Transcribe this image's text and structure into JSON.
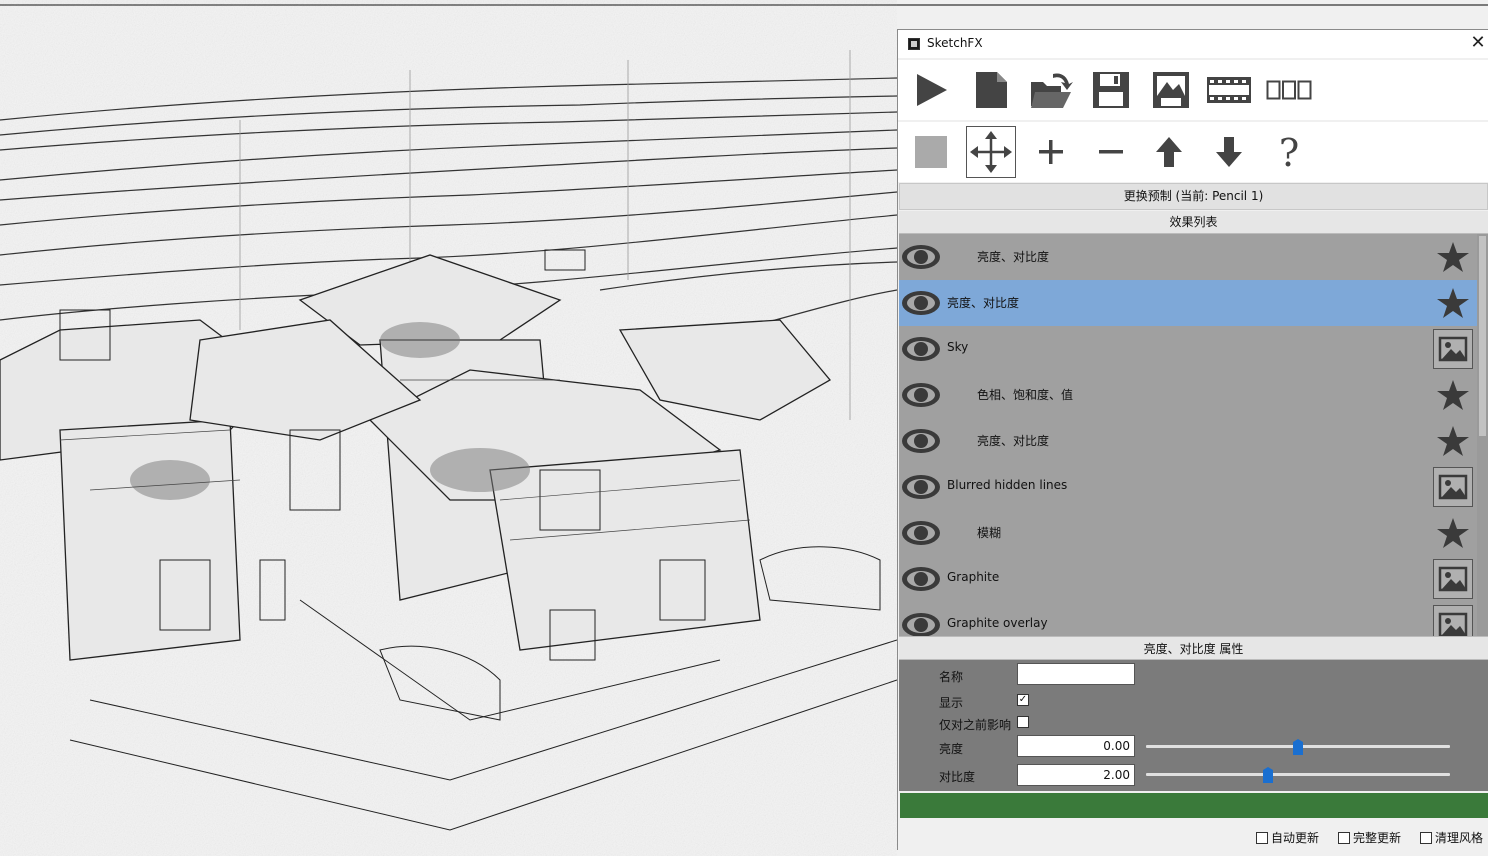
{
  "window": {
    "title": "SketchFX"
  },
  "toolbar_row1": [
    {
      "name": "play-icon"
    },
    {
      "name": "new-file-icon"
    },
    {
      "name": "open-folder-icon"
    },
    {
      "name": "save-icon"
    },
    {
      "name": "save-image-icon"
    },
    {
      "name": "film-strip-icon"
    },
    {
      "name": "layout-icon"
    }
  ],
  "toolbar_row2": [
    {
      "name": "gray-square-icon"
    },
    {
      "name": "move-icon",
      "selected": true
    },
    {
      "name": "plus-icon"
    },
    {
      "name": "minus-icon"
    },
    {
      "name": "arrow-up-icon"
    },
    {
      "name": "arrow-down-icon"
    },
    {
      "name": "help-icon"
    }
  ],
  "preset_button": "更换预制 (当前: Pencil 1)",
  "effects_header": "效果列表",
  "effects": [
    {
      "label": "亮度、对比度",
      "indent": true,
      "kind": "star",
      "selected": false
    },
    {
      "label": "亮度、对比度",
      "indent": false,
      "kind": "star",
      "selected": true
    },
    {
      "label": "Sky",
      "indent": false,
      "kind": "image",
      "selected": false
    },
    {
      "label": "色相、饱和度、值",
      "indent": true,
      "kind": "star",
      "selected": false
    },
    {
      "label": "亮度、对比度",
      "indent": true,
      "kind": "star",
      "selected": false
    },
    {
      "label": "Blurred hidden lines",
      "indent": false,
      "kind": "image",
      "selected": false
    },
    {
      "label": "模糊",
      "indent": true,
      "kind": "star",
      "selected": false
    },
    {
      "label": "Graphite",
      "indent": false,
      "kind": "image",
      "selected": false
    },
    {
      "label": "Graphite overlay",
      "indent": false,
      "kind": "image",
      "selected": false
    }
  ],
  "properties": {
    "header": "亮度、对比度 属性",
    "name_label": "名称",
    "name_value": "",
    "show_label": "显示",
    "show_checked": "✓",
    "prev_only_label": "仅对之前影响",
    "prev_only_checked": "",
    "brightness_label": "亮度",
    "brightness_value": "0.00",
    "brightness_slider": 0.5,
    "contrast_label": "对比度",
    "contrast_value": "2.00",
    "contrast_slider": 0.4
  },
  "bottom_options": [
    {
      "label": "自动更新"
    },
    {
      "label": "完整更新"
    },
    {
      "label": "清理风格"
    }
  ],
  "colors": {
    "selected_row": "#7ea8d8",
    "progress": "#3a7a3a",
    "slider_thumb": "#1a6fd0"
  }
}
